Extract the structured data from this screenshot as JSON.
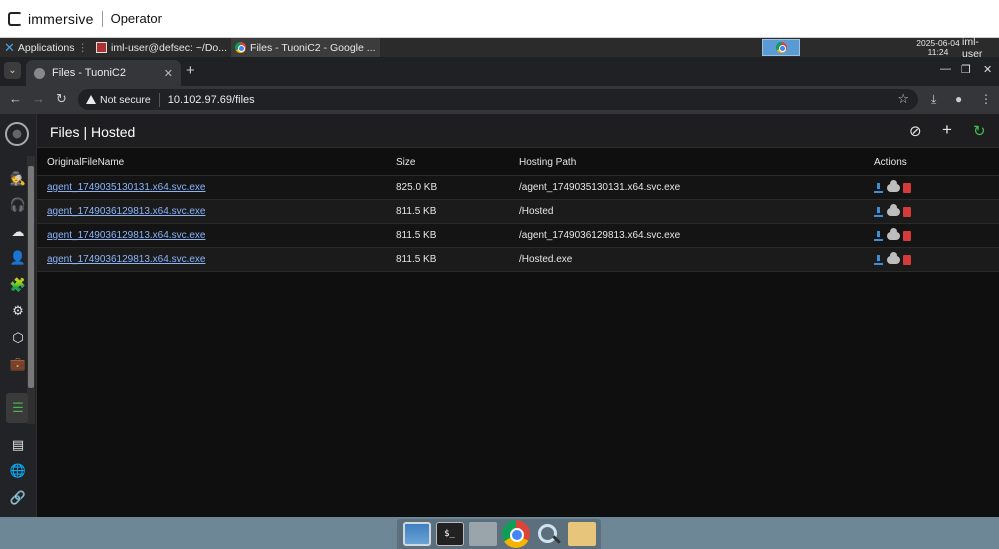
{
  "immersive": {
    "brand": "immersive",
    "product": "Operator"
  },
  "taskbar": {
    "applications": "Applications",
    "window1": "iml-user@defsec: ~/Do...",
    "window2": "Files - TuoniC2 - Google ...",
    "date": "2025-06-04",
    "time": "11:24",
    "user": "iml-user"
  },
  "browser": {
    "tab_title": "Files - TuoniC2",
    "security_label": "Not secure",
    "url": "10.102.97.69/files",
    "icons": [
      "back-arrow-icon",
      "forward-arrow-icon",
      "reload-icon",
      "star-icon",
      "download-icon",
      "profile-icon",
      "kebab-menu-icon"
    ]
  },
  "app": {
    "title": "Files | Hosted",
    "sidebar_icons": [
      "spy-icon",
      "headset-icon",
      "cloud-icon",
      "user-icon",
      "puzzle-icon",
      "gear-icon",
      "cube-icon",
      "briefcase-icon",
      "list-icon",
      "table-icon",
      "globe-icon",
      "link-icon"
    ],
    "header_icons": [
      "eye-off-icon",
      "plus-icon",
      "refresh-icon"
    ],
    "accent_refresh": "#3fbf4a"
  },
  "table": {
    "headers": [
      "OriginalFileName",
      "Size",
      "Hosting Path",
      "Actions"
    ],
    "rows": [
      {
        "name": "agent_1749035130131.x64.svc.exe",
        "size": "825.0 KB",
        "path": "/agent_1749035130131.x64.svc.exe"
      },
      {
        "name": "agent_1749036129813.x64.svc.exe",
        "size": "811.5 KB",
        "path": "/Hosted"
      },
      {
        "name": "agent_1749036129813.x64.svc.exe",
        "size": "811.5 KB",
        "path": "/agent_1749036129813.x64.svc.exe"
      },
      {
        "name": "agent_1749036129813.x64.svc.exe",
        "size": "811.5 KB",
        "path": "/Hosted.exe"
      }
    ],
    "action_colors": {
      "download": "#3b8fd9",
      "cloud": "#bdbdbd",
      "delete": "#d63a3a"
    }
  },
  "dock": {
    "items": [
      "desktop-icon",
      "terminal-icon",
      "home-folder-icon",
      "chrome-icon",
      "search-icon",
      "folder-icon"
    ],
    "terminal_glyph": "$_"
  }
}
